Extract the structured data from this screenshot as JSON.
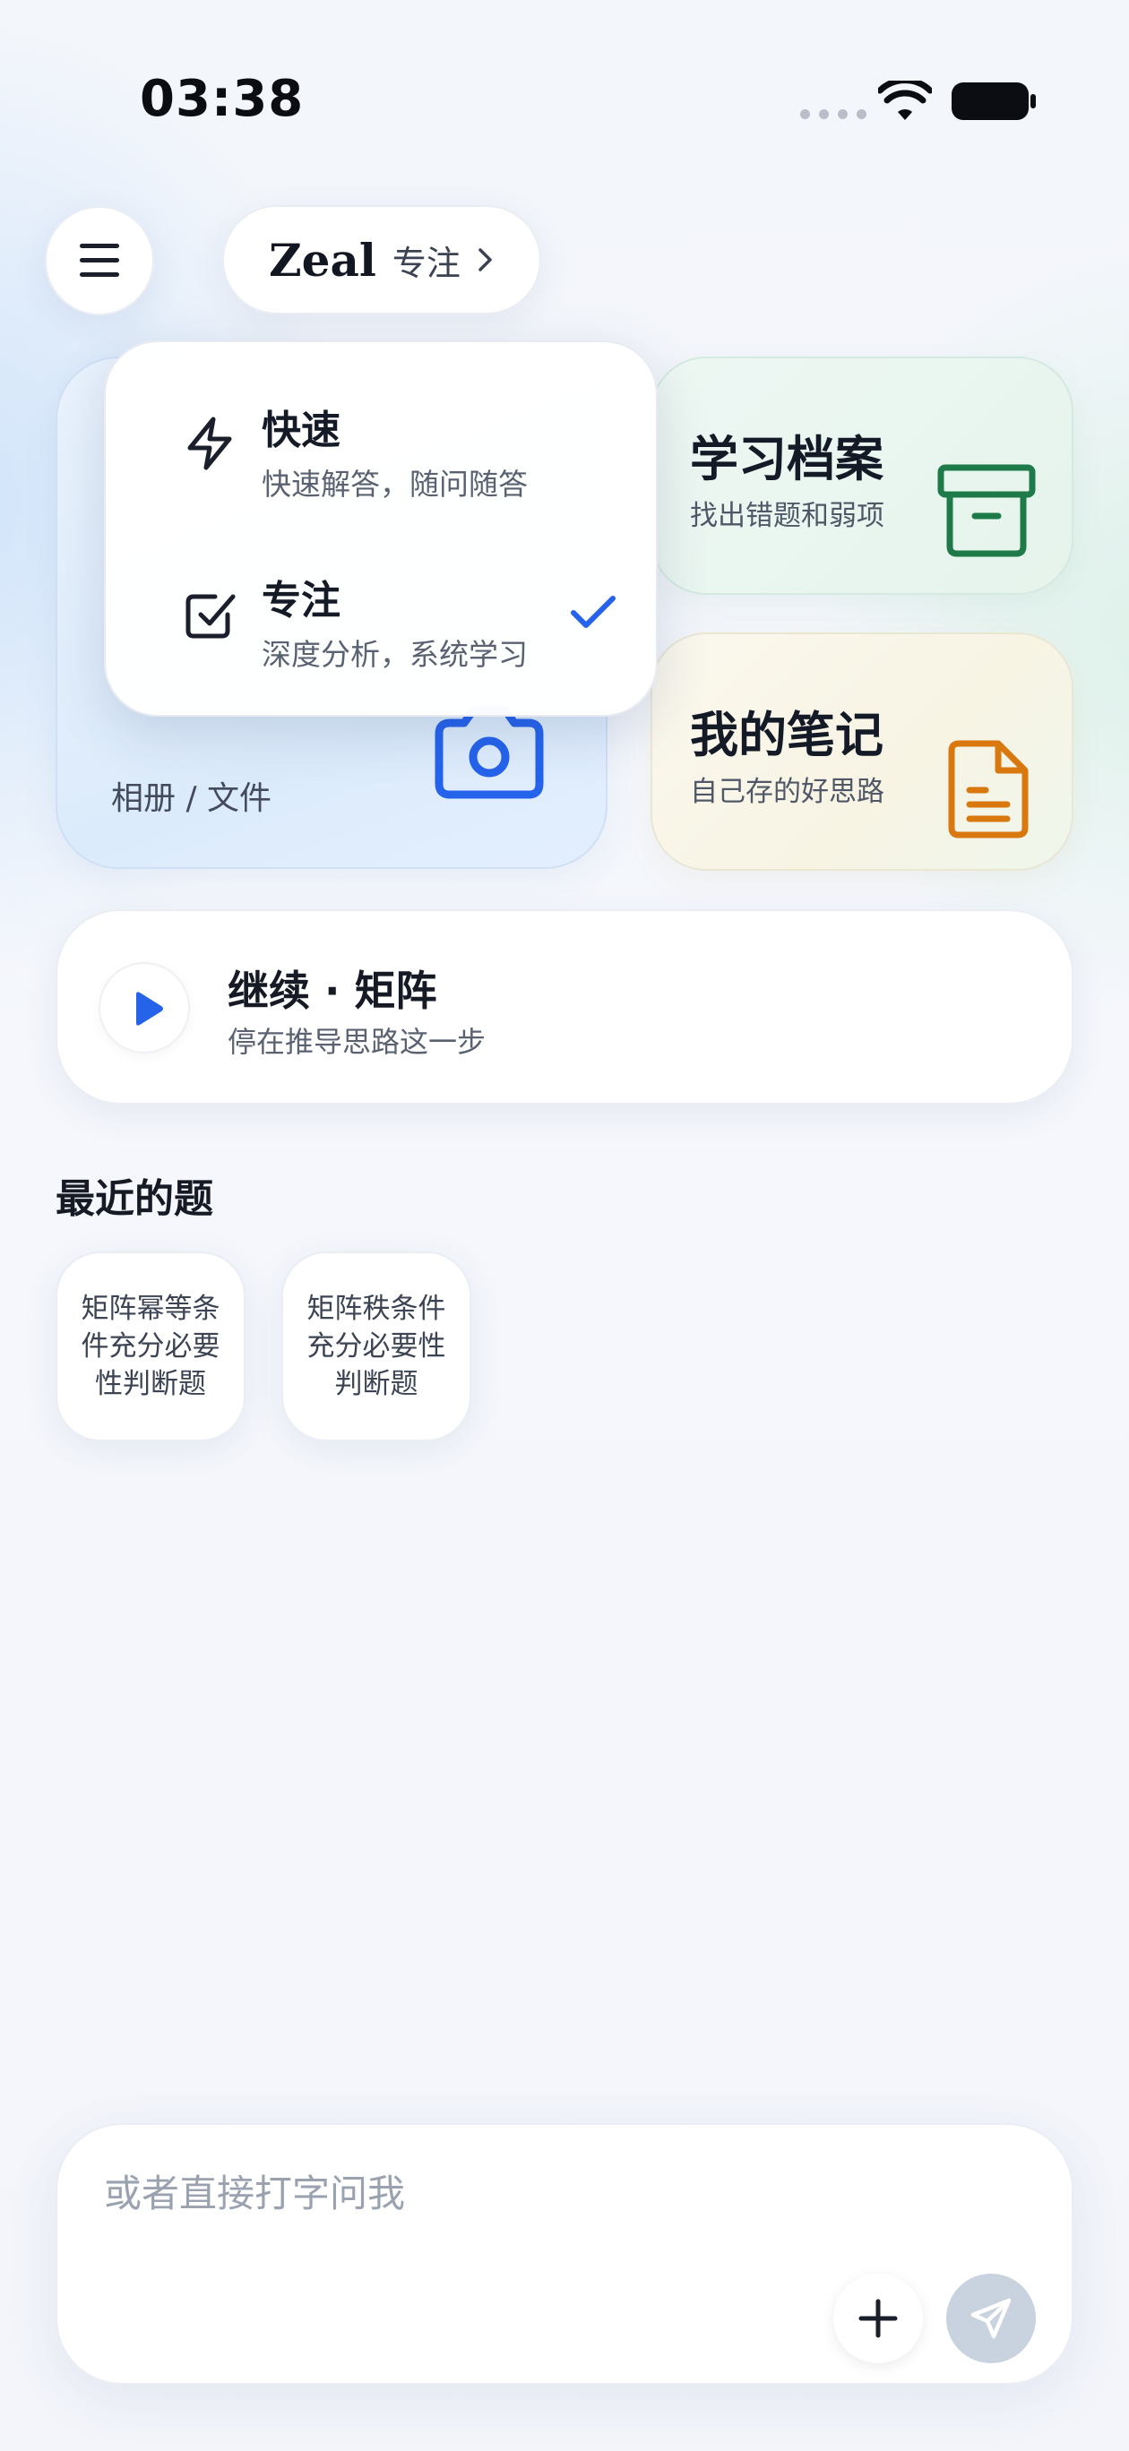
{
  "status_bar": {
    "time": "03:38",
    "icons": [
      "signal-dots-icon",
      "wifi-icon",
      "battery-icon"
    ]
  },
  "header": {
    "menu_icon": "hamburger-menu-icon",
    "brand": "Zeal",
    "mode": "专注",
    "chevron_icon": "chevron-right-icon"
  },
  "dropdown": {
    "options": [
      {
        "title": "快速",
        "subtitle": "快速解答，随问随答",
        "icon": "lightning-icon",
        "selected": false
      },
      {
        "title": "专注",
        "subtitle": "深度分析，系统学习",
        "icon": "checkbox-icon",
        "selected": true
      }
    ],
    "selected_icon": "checkmark-icon"
  },
  "cards": {
    "camera": {
      "label": "相册 / 文件",
      "icon": "camera-icon"
    },
    "archive": {
      "title": "学习档案",
      "subtitle": "找出错题和弱项",
      "icon": "archive-box-icon",
      "accent": "#1f7a4a"
    },
    "notes": {
      "title": "我的笔记",
      "subtitle": "自己存的好思路",
      "icon": "document-icon",
      "accent": "#d9780f"
    }
  },
  "continue": {
    "title": "继续 · 矩阵",
    "subtitle": "停在推导思路这一步",
    "icon": "play-icon"
  },
  "recent": {
    "title": "最近的题",
    "items": [
      "矩阵幂等条件充分必要性判断题",
      "矩阵秩条件充分必要性判断题"
    ]
  },
  "composer": {
    "placeholder": "或者直接打字问我",
    "add_icon": "plus-icon",
    "send_icon": "send-icon"
  },
  "colors": {
    "accent_blue": "#2563eb",
    "green": "#1f7a4a",
    "orange": "#d9780f"
  }
}
